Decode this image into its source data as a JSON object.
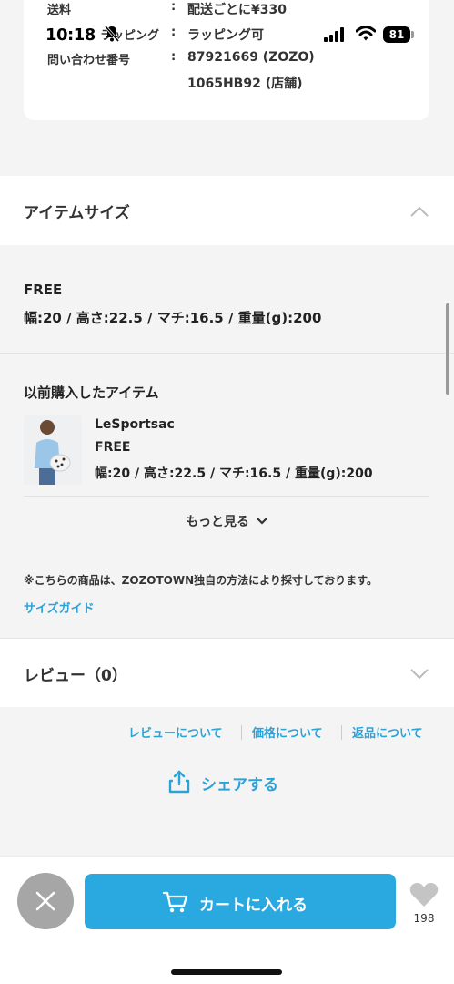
{
  "status_bar": {
    "time": "10:18",
    "battery": "81"
  },
  "info": {
    "rows": [
      {
        "label": "送料",
        "value": "配送ごとに¥330"
      },
      {
        "label": "ラッピング",
        "value": "ラッピング可"
      },
      {
        "label": "問い合わせ番号",
        "value": "87921669 (ZOZO)"
      },
      {
        "label": "",
        "value": "1065HB92 (店舗)"
      }
    ]
  },
  "size_section": {
    "title": "アイテムサイズ",
    "size_name": "FREE",
    "dimensions": "幅:20 / 高さ:22.5 / マチ:16.5 / 重量(g):200"
  },
  "previous_purchase": {
    "title": "以前購入したアイテム",
    "brand": "LeSportsac",
    "size": "FREE",
    "dimensions": "幅:20 / 高さ:22.5 / マチ:16.5 / 重量(g):200",
    "more_label": "もっと見る"
  },
  "note": "※こちらの商品は、ZOZOTOWN独自の方法により採寸しております。",
  "size_guide": "サイズガイド",
  "review_section": {
    "title": "レビュー（0）"
  },
  "footer_links": [
    "レビューについて",
    "価格について",
    "返品について"
  ],
  "share_label": "シェアする",
  "cart_label": "カートに入れる",
  "favorite_count": "198",
  "colors": {
    "accent": "#2aa9e0",
    "link": "#2ba3d9",
    "background": "#f4f4f4"
  },
  "icons": [
    "bell-muted-icon",
    "signal-icon",
    "wifi-icon",
    "battery-icon",
    "chevron-up-icon",
    "chevron-down-icon",
    "share-icon",
    "close-icon",
    "cart-icon",
    "heart-icon"
  ]
}
